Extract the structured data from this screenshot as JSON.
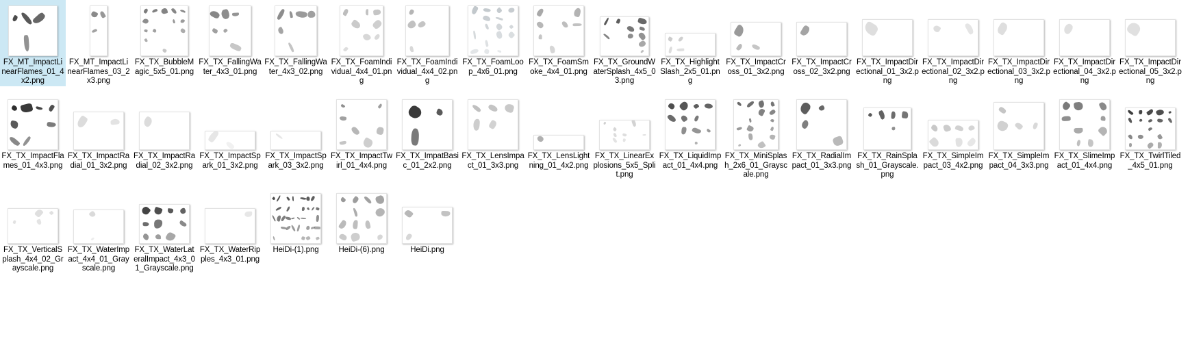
{
  "view": {
    "name": "windows-explorer-thumbnail-grid",
    "background": "#ffffff",
    "selection_color": "#cce8f4",
    "columns": 18,
    "rows": 3
  },
  "files": [
    {
      "name": "FX_MT_ImpactLinearFlames_01_4x2.png",
      "selected": true,
      "cols": 4,
      "rows": 2,
      "tw": 72,
      "th": 74,
      "density": 0.55,
      "tone": "#4a4a4a"
    },
    {
      "name": "FX_MT_ImpactLinearFlames_03_2x3.png",
      "selected": false,
      "cols": 2,
      "rows": 3,
      "tw": 26,
      "th": 74,
      "density": 0.35,
      "tone": "#8a8a8a"
    },
    {
      "name": "FX_TX_BubbleMagic_5x5_01.png",
      "selected": false,
      "cols": 5,
      "rows": 5,
      "tw": 70,
      "th": 74,
      "density": 0.7,
      "tone": "#7d7d7d"
    },
    {
      "name": "FX_TX_FallingWater_4x3_01.png",
      "selected": false,
      "cols": 4,
      "rows": 3,
      "tw": 62,
      "th": 74,
      "density": 0.5,
      "tone": "#878787"
    },
    {
      "name": "FX_TX_FallingWater_4x3_02.png",
      "selected": false,
      "cols": 4,
      "rows": 3,
      "tw": 62,
      "th": 74,
      "density": 0.5,
      "tone": "#8d8d8d"
    },
    {
      "name": "FX_TX_FoamIndividual_4x4_01.png",
      "selected": false,
      "cols": 4,
      "rows": 4,
      "tw": 64,
      "th": 74,
      "density": 0.4,
      "tone": "#bdbdbd"
    },
    {
      "name": "FX_TX_FoamIndividual_4x4_02.png",
      "selected": false,
      "cols": 4,
      "rows": 4,
      "tw": 64,
      "th": 74,
      "density": 0.4,
      "tone": "#b5b5b5"
    },
    {
      "name": "FX_TX_FoamLoop_4x6_01.png",
      "selected": false,
      "cols": 4,
      "rows": 6,
      "tw": 74,
      "th": 74,
      "density": 0.6,
      "tone": "#c2c8cc"
    },
    {
      "name": "FX_TX_FoamSmoke_4x4_01.png",
      "selected": false,
      "cols": 4,
      "rows": 4,
      "tw": 74,
      "th": 74,
      "density": 0.55,
      "tone": "#a9a9a9"
    },
    {
      "name": "FX_TX_GroundWaterSplash_4x5_03.png",
      "selected": false,
      "cols": 4,
      "rows": 5,
      "tw": 72,
      "th": 58,
      "density": 0.5,
      "tone": "#585858"
    },
    {
      "name": "FX_TX_HighlightSlash_2x5_01.png",
      "selected": false,
      "cols": 5,
      "rows": 2,
      "tw": 74,
      "th": 34,
      "density": 0.25,
      "tone": "#cccccc"
    },
    {
      "name": "FX_TX_ImpactCross_01_3x2.png",
      "selected": false,
      "cols": 3,
      "rows": 2,
      "tw": 74,
      "th": 50,
      "density": 0.45,
      "tone": "#9a9a9a"
    },
    {
      "name": "FX_TX_ImpactCross_02_3x2.png",
      "selected": false,
      "cols": 3,
      "rows": 2,
      "tw": 74,
      "th": 50,
      "density": 0.45,
      "tone": "#a4a4a4"
    },
    {
      "name": "FX_TX_ImpactDirectional_01_3x2.png",
      "selected": false,
      "cols": 3,
      "rows": 2,
      "tw": 74,
      "th": 54,
      "density": 0.18,
      "tone": "#dedede"
    },
    {
      "name": "FX_TX_ImpactDirectional_02_3x2.png",
      "selected": false,
      "cols": 3,
      "rows": 2,
      "tw": 74,
      "th": 54,
      "density": 0.18,
      "tone": "#dedede"
    },
    {
      "name": "FX_TX_ImpactDirectional_03_3x2.png",
      "selected": false,
      "cols": 3,
      "rows": 2,
      "tw": 74,
      "th": 54,
      "density": 0.18,
      "tone": "#dedede"
    },
    {
      "name": "FX_TX_ImpactDirectional_04_3x2.png",
      "selected": false,
      "cols": 3,
      "rows": 2,
      "tw": 74,
      "th": 54,
      "density": 0.16,
      "tone": "#e0e0e0"
    },
    {
      "name": "FX_TX_ImpactDirectional_05_3x2.png",
      "selected": false,
      "cols": 3,
      "rows": 2,
      "tw": 74,
      "th": 54,
      "density": 0.16,
      "tone": "#e0e0e0"
    },
    {
      "name": "FX_TX_ImpactFlames_01_4x3.png",
      "selected": false,
      "cols": 4,
      "rows": 3,
      "tw": 74,
      "th": 74,
      "density": 0.75,
      "tone": "#2e2e2e"
    },
    {
      "name": "FX_TX_ImpactRadial_01_3x2.png",
      "selected": false,
      "cols": 3,
      "rows": 2,
      "tw": 74,
      "th": 56,
      "density": 0.22,
      "tone": "#dcdcdc"
    },
    {
      "name": "FX_TX_ImpactRadial_02_3x2.png",
      "selected": false,
      "cols": 3,
      "rows": 2,
      "tw": 74,
      "th": 56,
      "density": 0.22,
      "tone": "#dcdcdc"
    },
    {
      "name": "FX_TX_ImpactSpark_01_3x2.png",
      "selected": false,
      "cols": 3,
      "rows": 2,
      "tw": 74,
      "th": 28,
      "density": 0.14,
      "tone": "#e6e6e6"
    },
    {
      "name": "FX_TX_ImpactSpark_03_3x2.png",
      "selected": false,
      "cols": 3,
      "rows": 2,
      "tw": 74,
      "th": 28,
      "density": 0.14,
      "tone": "#e6e6e6"
    },
    {
      "name": "FX_TX_ImpactTwirl_01_4x4.png",
      "selected": false,
      "cols": 4,
      "rows": 4,
      "tw": 74,
      "th": 74,
      "density": 0.45,
      "tone": "#8f8f8f"
    },
    {
      "name": "FX_TX_ImpatBasic_01_2x2.png",
      "selected": false,
      "cols": 2,
      "rows": 2,
      "tw": 74,
      "th": 74,
      "density": 0.65,
      "tone": "#3a3a3a"
    },
    {
      "name": "FX_TX_LensImpact_01_3x3.png",
      "selected": false,
      "cols": 3,
      "rows": 3,
      "tw": 74,
      "th": 74,
      "density": 0.35,
      "tone": "#c0c0c0"
    },
    {
      "name": "FX_TX_LensLightning_01_4x2.png",
      "selected": false,
      "cols": 4,
      "rows": 2,
      "tw": 74,
      "th": 22,
      "density": 0.3,
      "tone": "#b0b0b0"
    },
    {
      "name": "FX_TX_LinearExplosions_5x5_Split.png",
      "selected": false,
      "cols": 5,
      "rows": 5,
      "tw": 74,
      "th": 44,
      "density": 0.3,
      "tone": "#cfcfcf"
    },
    {
      "name": "FX_TX_LiquidImpact_01_4x4.png",
      "selected": false,
      "cols": 4,
      "rows": 4,
      "tw": 74,
      "th": 74,
      "density": 0.7,
      "tone": "#4f4f4f"
    },
    {
      "name": "FX_TX_MiniSplash_2x6_01_Grayscale.png",
      "selected": false,
      "cols": 4,
      "rows": 6,
      "tw": 66,
      "th": 74,
      "density": 0.55,
      "tone": "#6a6a6a"
    },
    {
      "name": "FX_TX_RadialImpact_01_3x3.png",
      "selected": false,
      "cols": 3,
      "rows": 3,
      "tw": 74,
      "th": 74,
      "density": 0.6,
      "tone": "#5d5d5d"
    },
    {
      "name": "FX_TX_RainSplash_01_Grayscale.png",
      "selected": false,
      "cols": 4,
      "rows": 3,
      "tw": 70,
      "th": 62,
      "density": 0.5,
      "tone": "#5a5a5a"
    },
    {
      "name": "FX_TX_SimpleImpact_03_4x2.png",
      "selected": false,
      "cols": 4,
      "rows": 2,
      "tw": 74,
      "th": 44,
      "density": 0.28,
      "tone": "#c8c8c8"
    },
    {
      "name": "FX_TX_SimpleImpact_04_3x3.png",
      "selected": false,
      "cols": 3,
      "rows": 3,
      "tw": 74,
      "th": 70,
      "density": 0.3,
      "tone": "#c5c5c5"
    },
    {
      "name": "FX_TX_SlimeImpact_01_4x4.png",
      "selected": false,
      "cols": 4,
      "rows": 4,
      "tw": 74,
      "th": 74,
      "density": 0.5,
      "tone": "#7a7a7a"
    },
    {
      "name": "FX_TX_TwirlTiled_4x5_01.png",
      "selected": false,
      "cols": 5,
      "rows": 5,
      "tw": 74,
      "th": 62,
      "density": 0.72,
      "tone": "#3f3f3f"
    },
    {
      "name": "FX_TX_VerticalSplash_4x4_02_Grayscale.png",
      "selected": false,
      "cols": 4,
      "rows": 4,
      "tw": 74,
      "th": 52,
      "density": 0.18,
      "tone": "#dcdcdc"
    },
    {
      "name": "FX_TX_WaterImpact_4x4_01_Grayscale.png",
      "selected": false,
      "cols": 4,
      "rows": 4,
      "tw": 74,
      "th": 50,
      "density": 0.2,
      "tone": "#d8d8d8"
    },
    {
      "name": "FX_TX_WaterLateralImpact_4x3_01_Grayscale.png",
      "selected": false,
      "cols": 4,
      "rows": 3,
      "tw": 74,
      "th": 58,
      "density": 0.62,
      "tone": "#444444"
    },
    {
      "name": "FX_TX_WaterRipples_4x3_01.png",
      "selected": false,
      "cols": 4,
      "rows": 3,
      "tw": 74,
      "th": 52,
      "density": 0.16,
      "tone": "#e2e2e2"
    },
    {
      "name": "HeiDi-(1).png",
      "selected": false,
      "cols": 10,
      "rows": 5,
      "tw": 74,
      "th": 74,
      "density": 0.68,
      "tone": "#4c4c4c"
    },
    {
      "name": "HeiDi-(6).png",
      "selected": false,
      "cols": 4,
      "rows": 4,
      "tw": 74,
      "th": 74,
      "density": 0.55,
      "tone": "#999999"
    },
    {
      "name": "HeiDi.png",
      "selected": false,
      "cols": 4,
      "rows": 3,
      "tw": 74,
      "th": 54,
      "density": 0.35,
      "tone": "#b8b8b8"
    }
  ]
}
